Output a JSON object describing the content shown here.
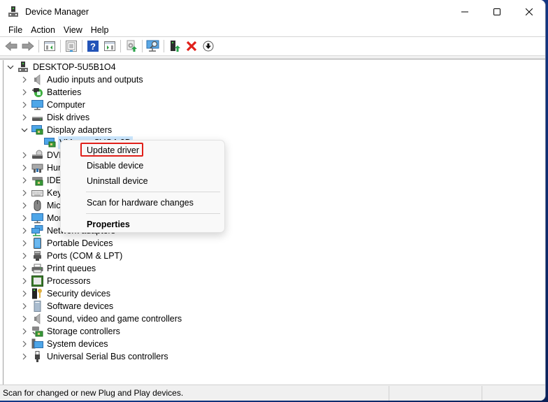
{
  "window": {
    "title": "Device Manager",
    "controls": [
      "minimize-icon",
      "maximize-icon",
      "close-icon"
    ]
  },
  "menubar": {
    "items": [
      "File",
      "Action",
      "View",
      "Help"
    ]
  },
  "toolbar": {
    "buttons": [
      {
        "icon": "back-arrow-icon",
        "tooltip": "Back"
      },
      {
        "icon": "forward-arrow-icon",
        "tooltip": "Forward"
      },
      {
        "icon": "show-hide-console-tree-icon"
      },
      {
        "icon": "properties-icon"
      },
      {
        "icon": "help-icon"
      },
      {
        "icon": "show-action-pane-icon"
      },
      {
        "icon": "update-driver-icon"
      },
      {
        "icon": "scan-hardware-icon"
      },
      {
        "icon": "enable-device-icon"
      },
      {
        "icon": "uninstall-device-icon"
      },
      {
        "icon": "disable-device-icon"
      }
    ]
  },
  "tree": {
    "root": {
      "label": "DESKTOP-5U5B1O4",
      "expanded": true
    },
    "items": [
      {
        "label": "Audio inputs and outputs",
        "icon": "speaker-icon",
        "expanded": false
      },
      {
        "label": "Batteries",
        "icon": "battery-icon",
        "expanded": false
      },
      {
        "label": "Computer",
        "icon": "monitor-icon",
        "expanded": false
      },
      {
        "label": "Disk drives",
        "icon": "disk-drive-icon",
        "expanded": false
      },
      {
        "label": "Display adapters",
        "icon": "display-adapter-icon",
        "expanded": true,
        "children": [
          {
            "label": "VMware SVGA 3D",
            "icon": "display-adapter-icon",
            "selected": true
          }
        ]
      },
      {
        "label": "DVD/CD-ROM drives",
        "icon": "dvd-drive-icon",
        "expanded": false
      },
      {
        "label": "Human Interface Devices",
        "icon": "hid-icon",
        "expanded": false
      },
      {
        "label": "IDE ATA/ATAPI controllers",
        "icon": "ide-controller-icon",
        "expanded": false
      },
      {
        "label": "Keyboards",
        "icon": "keyboard-icon",
        "expanded": false
      },
      {
        "label": "Mice and other pointing devices",
        "icon": "mouse-icon",
        "expanded": false
      },
      {
        "label": "Monitors",
        "icon": "monitor-icon",
        "expanded": false
      },
      {
        "label": "Network adapters",
        "icon": "network-adapter-icon",
        "expanded": false
      },
      {
        "label": "Portable Devices",
        "icon": "portable-device-icon",
        "expanded": false
      },
      {
        "label": "Ports (COM & LPT)",
        "icon": "port-icon",
        "expanded": false
      },
      {
        "label": "Print queues",
        "icon": "printer-icon",
        "expanded": false
      },
      {
        "label": "Processors",
        "icon": "processor-icon",
        "expanded": false
      },
      {
        "label": "Security devices",
        "icon": "security-device-icon",
        "expanded": false
      },
      {
        "label": "Software devices",
        "icon": "software-device-icon",
        "expanded": false
      },
      {
        "label": "Sound, video and game controllers",
        "icon": "speaker-icon",
        "expanded": false
      },
      {
        "label": "Storage controllers",
        "icon": "storage-controller-icon",
        "expanded": false
      },
      {
        "label": "System devices",
        "icon": "system-device-icon",
        "expanded": false
      },
      {
        "label": "Universal Serial Bus controllers",
        "icon": "usb-icon",
        "expanded": false
      }
    ]
  },
  "context_menu": {
    "items": [
      {
        "label": "Update driver",
        "highlighted": true
      },
      {
        "label": "Disable device"
      },
      {
        "label": "Uninstall device"
      },
      {
        "separator": true
      },
      {
        "label": "Scan for hardware changes"
      },
      {
        "separator": true
      },
      {
        "label": "Properties",
        "bold": true
      }
    ],
    "highlight_color": "#e0201a"
  },
  "statusbar": {
    "text": "Scan for changed or new Plug and Play devices."
  },
  "colors": {
    "selection": "#cce8ff",
    "desktop": "#14398a"
  }
}
